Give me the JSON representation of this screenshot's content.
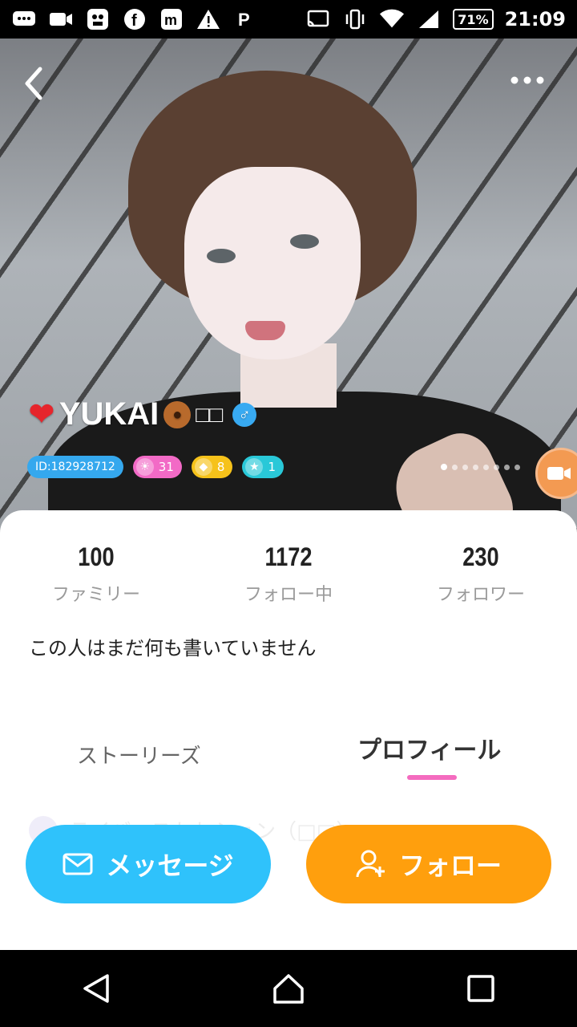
{
  "status_bar": {
    "icons": [
      "message-icon",
      "video-icon",
      "ghost-icon",
      "facebook-icon",
      "m-app-icon",
      "warning-icon",
      "parking-icon",
      "cast-icon",
      "vibrate-icon",
      "wifi-icon",
      "signal-icon"
    ],
    "battery": "71%",
    "time": "21:09"
  },
  "header": {
    "back_icon": "chevron-left-icon",
    "more_icon": "more-dots-icon"
  },
  "profile": {
    "heart": "❤",
    "name": "YUKAI",
    "name_suffix": "□□",
    "gender_symbol": "♂",
    "badges": {
      "id": "ID:182928712",
      "sun_level": "31",
      "gem_level": "8",
      "star_level": "1"
    },
    "photo_page_count": 8,
    "photo_page_active": 0
  },
  "stats": [
    {
      "value": "100",
      "label": "ファミリー"
    },
    {
      "value": "1172",
      "label": "フォロー中"
    },
    {
      "value": "230",
      "label": "フォロワー"
    }
  ],
  "bio": "この人はまだ何も書いていません",
  "tabs": {
    "stories": "ストーリーズ",
    "profile": "プロフィール"
  },
  "faded_row_text": "ライバーストセション（□□）",
  "actions": {
    "message": "メッセージ",
    "follow": "フォロー"
  },
  "colors": {
    "message_button": "#2fc2fb",
    "follow_button": "#ff9f0d",
    "tab_indicator": "#f46bbf"
  }
}
